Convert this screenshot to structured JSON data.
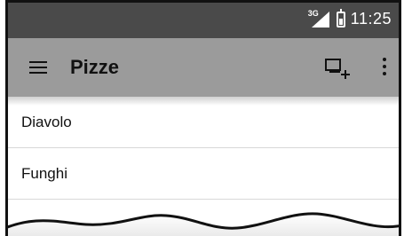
{
  "status_bar": {
    "network_label": "3G",
    "time": "11:25",
    "icons": [
      "signal-icon",
      "battery-icon"
    ]
  },
  "toolbar": {
    "title": "Pizze",
    "icons": [
      "menu-icon",
      "add-to-list-icon",
      "more-vert-icon"
    ]
  },
  "list": {
    "items": [
      {
        "label": "Diavolo"
      },
      {
        "label": "Funghi"
      }
    ]
  },
  "colors": {
    "status_bar": "#4a4a4a",
    "toolbar": "#9b9b9b",
    "background": "#ffffff",
    "divider": "#d8d8d8"
  }
}
